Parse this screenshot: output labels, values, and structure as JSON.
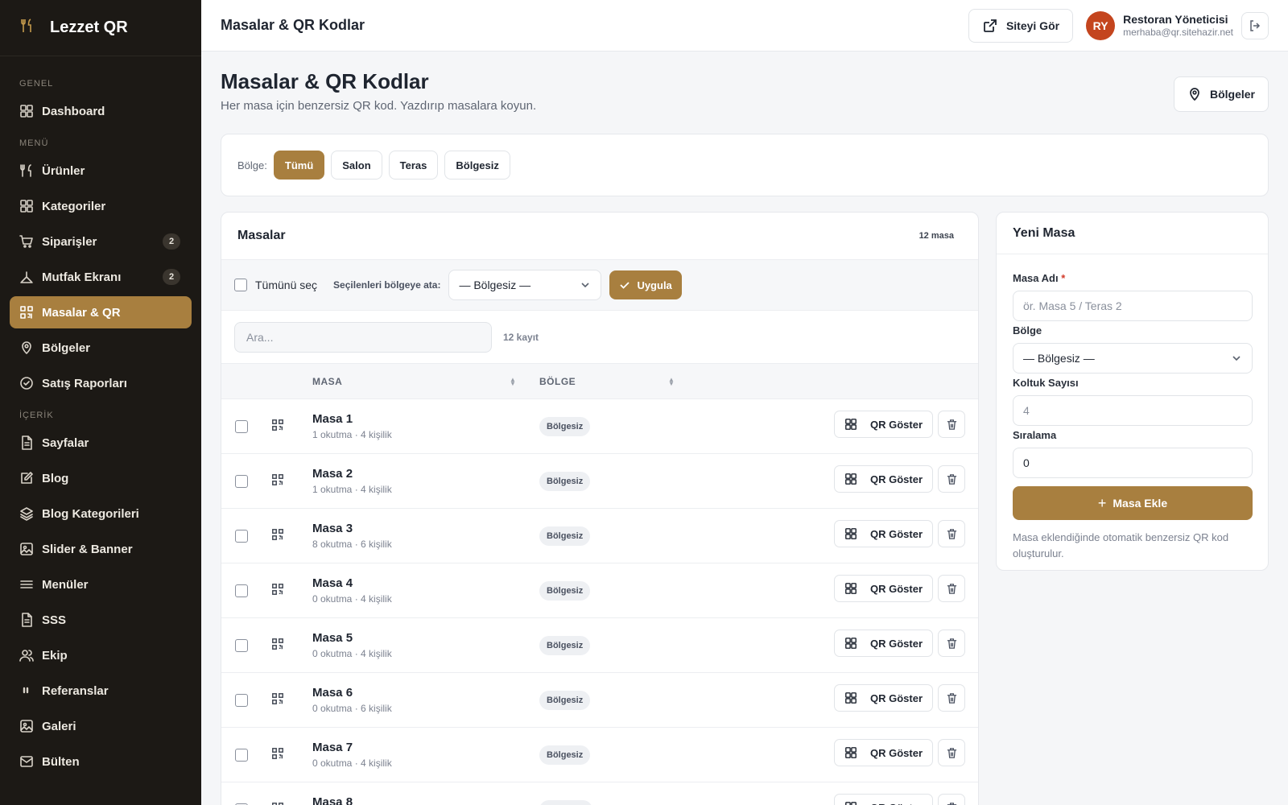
{
  "app": {
    "brand": "Lezzet QR"
  },
  "sidebar": {
    "sections": [
      {
        "title": "GENEL",
        "items": [
          {
            "label": "Dashboard",
            "icon": "grid-icon"
          }
        ]
      },
      {
        "title": "MENÜ",
        "items": [
          {
            "label": "Ürünler",
            "icon": "utensils-icon"
          },
          {
            "label": "Kategoriler",
            "icon": "grid-icon"
          },
          {
            "label": "Siparişler",
            "icon": "cart-icon",
            "badge": "2"
          },
          {
            "label": "Mutfak Ekranı",
            "icon": "chef-hat-icon",
            "badge": "2"
          },
          {
            "label": "Masalar & QR",
            "icon": "qr-icon",
            "active": true
          },
          {
            "label": "Bölgeler",
            "icon": "map-pin-icon"
          },
          {
            "label": "Satış Raporları",
            "icon": "chart-icon"
          }
        ]
      },
      {
        "title": "İÇERİK",
        "items": [
          {
            "label": "Sayfalar",
            "icon": "file-icon"
          },
          {
            "label": "Blog",
            "icon": "edit-icon"
          },
          {
            "label": "Blog Kategorileri",
            "icon": "layers-icon"
          },
          {
            "label": "Slider & Banner",
            "icon": "image-icon"
          },
          {
            "label": "Menüler",
            "icon": "menu-icon"
          },
          {
            "label": "SSS",
            "icon": "file-icon"
          },
          {
            "label": "Ekip",
            "icon": "users-icon"
          },
          {
            "label": "Referanslar",
            "icon": "quote-icon"
          },
          {
            "label": "Galeri",
            "icon": "image-icon"
          },
          {
            "label": "Bülten",
            "icon": "mail-icon"
          }
        ]
      }
    ]
  },
  "topbar": {
    "title": "Masalar & QR Kodlar",
    "view_site": "Siteyi Gör",
    "user": {
      "initials": "RY",
      "name": "Restoran Yöneticisi",
      "email": "merhaba@qr.sitehazir.net"
    }
  },
  "page": {
    "title": "Masalar & QR Kodlar",
    "subtitle": "Her masa için benzersiz QR kod. Yazdırıp masalara koyun.",
    "regions_button": "Bölgeler"
  },
  "filter": {
    "label": "Bölge:",
    "chips": [
      {
        "label": "Tümü",
        "active": true
      },
      {
        "label": "Salon"
      },
      {
        "label": "Teras"
      },
      {
        "label": "Bölgesiz"
      }
    ]
  },
  "tables": {
    "title": "Masalar",
    "count": "12 masa",
    "bulk": {
      "select_all": "Tümünü seç",
      "assign_label": "Seçilenleri bölgeye ata:",
      "selected_region": "— Bölgesiz —",
      "apply": "Uygula"
    },
    "search": {
      "placeholder": "Ara...",
      "count": "12 kayıt"
    },
    "columns": {
      "masa": "MASA",
      "bolge": "BÖLGE"
    },
    "qr_label": "QR Göster",
    "rows": [
      {
        "name": "Masa 1",
        "meta": "1 okutma · 4 kişilik",
        "region": "Bölgesiz"
      },
      {
        "name": "Masa 2",
        "meta": "1 okutma · 4 kişilik",
        "region": "Bölgesiz"
      },
      {
        "name": "Masa 3",
        "meta": "8 okutma · 6 kişilik",
        "region": "Bölgesiz"
      },
      {
        "name": "Masa 4",
        "meta": "0 okutma · 4 kişilik",
        "region": "Bölgesiz"
      },
      {
        "name": "Masa 5",
        "meta": "0 okutma · 4 kişilik",
        "region": "Bölgesiz"
      },
      {
        "name": "Masa 6",
        "meta": "0 okutma · 6 kişilik",
        "region": "Bölgesiz"
      },
      {
        "name": "Masa 7",
        "meta": "0 okutma · 4 kişilik",
        "region": "Bölgesiz"
      },
      {
        "name": "Masa 8",
        "meta": "",
        "region": ""
      }
    ]
  },
  "new_table": {
    "title": "Yeni Masa",
    "name_label": "Masa Adı",
    "name_placeholder": "ör. Masa 5 / Teras 2",
    "region_label": "Bölge",
    "region_value": "— Bölgesiz —",
    "seats_label": "Koltuk Sayısı",
    "seats_value": "4",
    "order_label": "Sıralama",
    "order_value": "0",
    "add_button": "Masa Ekle",
    "help": "Masa eklendiğinde otomatik benzersiz QR kod oluşturulur."
  },
  "colors": {
    "accent": "#a87f3f",
    "sidebar_bg": "#1c1915",
    "avatar": "#c4451e"
  }
}
